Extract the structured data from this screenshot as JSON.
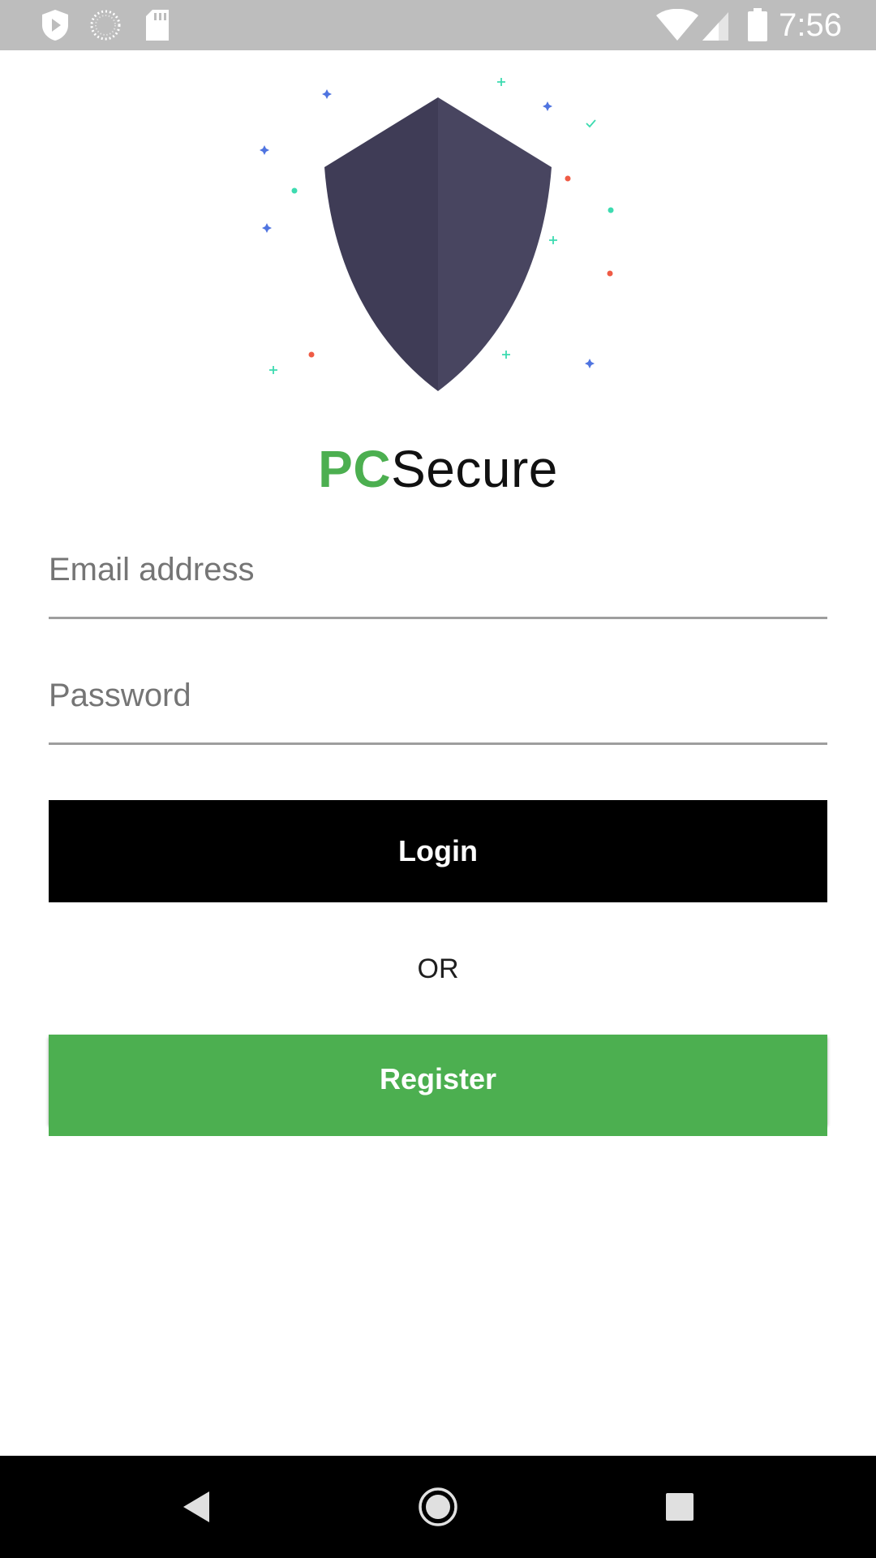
{
  "status_bar": {
    "time": "7:56",
    "left_icons": [
      "shield-play-icon",
      "loading-circle-icon",
      "sd-card-icon"
    ],
    "right_icons": [
      "wifi-icon",
      "cell-signal-icon",
      "battery-icon"
    ]
  },
  "brand": {
    "prefix": "PC",
    "suffix": "Secure",
    "accent_color": "#4caf50"
  },
  "form": {
    "email_label": "Email address",
    "email_value": "",
    "password_label": "Password",
    "password_value": ""
  },
  "buttons": {
    "login_label": "Login",
    "or_label": "OR",
    "register_label": "Register"
  },
  "colors": {
    "login_bg": "#000000",
    "register_bg": "#4caf50",
    "shield_left": "#3f3c56",
    "shield_right": "#484560",
    "status_bar_bg": "#bdbdbd"
  },
  "nav_bar": {
    "icons": [
      "back-icon",
      "home-icon",
      "recents-icon"
    ]
  }
}
